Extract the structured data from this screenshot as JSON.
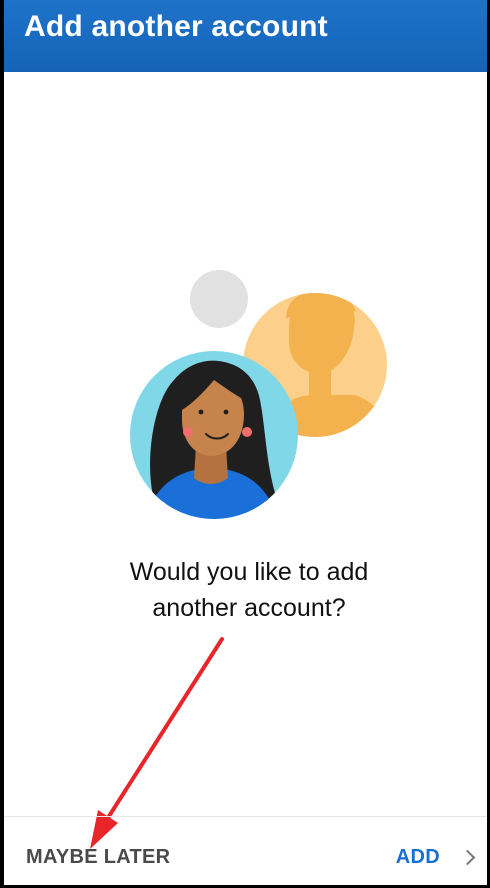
{
  "header": {
    "title": "Add another account"
  },
  "prompt": {
    "line1": "Would you like to add",
    "line2": "another account?"
  },
  "actions": {
    "maybe_later": "MAYBE LATER",
    "add": "ADD"
  },
  "icons": {
    "illustration": "accounts-people-illustration",
    "add_chevron": "chevron-right-icon",
    "annotation": "red-arrow-annotation"
  },
  "colors": {
    "header": "#1a6cc4",
    "accent": "#1a6fd0",
    "annotation": "#e8262a"
  }
}
